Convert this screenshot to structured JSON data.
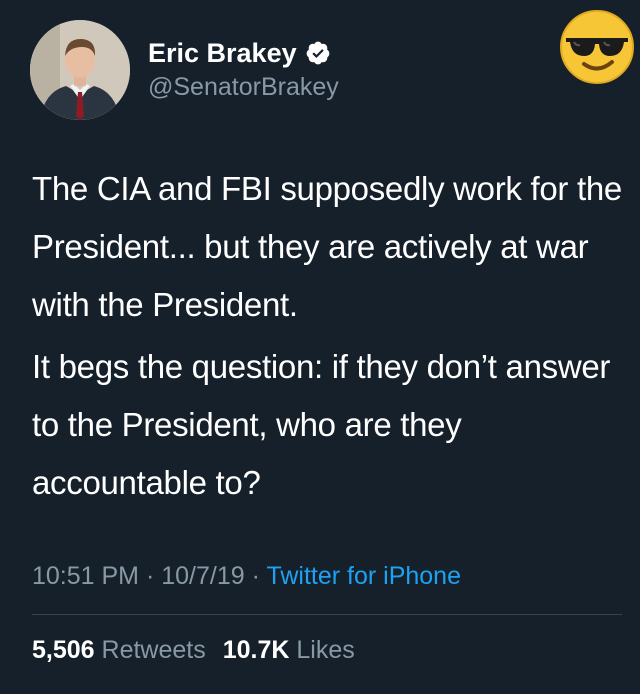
{
  "tweet": {
    "author": {
      "name": "Eric Brakey",
      "handle": "@SenatorBrakey",
      "verified_icon": "verified-badge-icon"
    },
    "paragraphs": [
      "The CIA and FBI supposedly work for the President... but they are actively at war with the President.",
      "It begs the question: if they don’t answer to the President, who are they accountable to?"
    ],
    "time": "10:51 PM",
    "date": "10/7/19",
    "separator": "·",
    "source": "Twitter for iPhone",
    "stats": {
      "retweets_count": "5,506",
      "retweets_label": "Retweets",
      "likes_count": "10.7K",
      "likes_label": "Likes"
    }
  },
  "sticker": {
    "icon": "sunglasses-emoji-icon"
  },
  "colors": {
    "background": "#15202b",
    "text": "#ffffff",
    "secondary": "#8899a6",
    "link": "#1da1f2",
    "divider": "#38444d"
  }
}
